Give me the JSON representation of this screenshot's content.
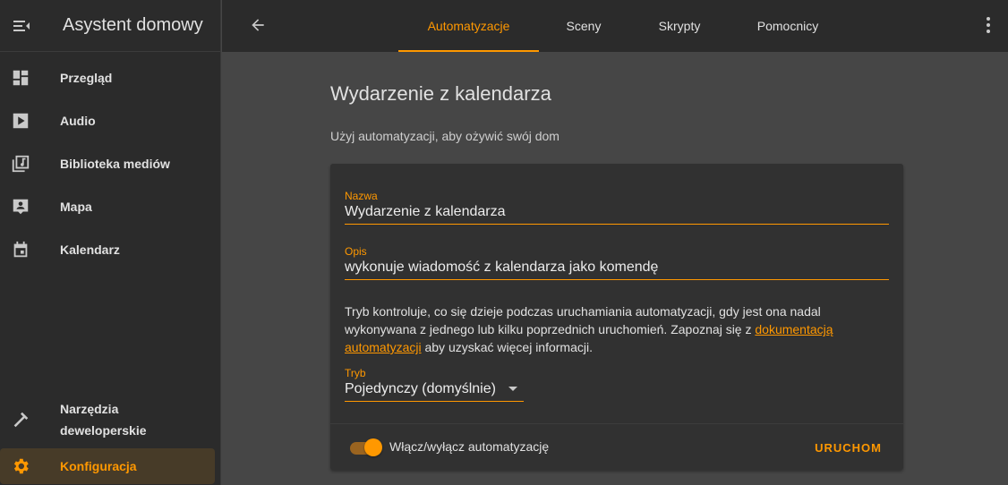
{
  "colors": {
    "accent": "#ff9800",
    "sidebar_bg": "#2b2b2b",
    "main_bg": "#464646",
    "card_bg": "#313131"
  },
  "sidebar": {
    "title": "Asystent domowy",
    "items": [
      {
        "label": "Przegląd",
        "icon": "dashboard-icon"
      },
      {
        "label": "Audio",
        "icon": "play-icon"
      },
      {
        "label": "Biblioteka mediów",
        "icon": "media-library-icon"
      },
      {
        "label": "Mapa",
        "icon": "map-person-icon"
      },
      {
        "label": "Kalendarz",
        "icon": "calendar-icon"
      }
    ],
    "bottom_items": [
      {
        "label": "Narzędzia deweloperskie",
        "icon": "hammer-icon"
      },
      {
        "label": "Konfiguracja",
        "icon": "gear-icon",
        "active": true
      }
    ]
  },
  "topbar": {
    "tabs": [
      {
        "label": "Automatyzacje",
        "active": true
      },
      {
        "label": "Sceny"
      },
      {
        "label": "Skrypty"
      },
      {
        "label": "Pomocnicy"
      }
    ]
  },
  "page": {
    "heading": "Wydarzenie z kalendarza",
    "subheading": "Użyj automatyzacji, aby ożywić swój dom"
  },
  "form": {
    "name_label": "Nazwa",
    "name_value": "Wydarzenie z kalendarza",
    "description_label": "Opis",
    "description_value": "wykonuje wiadomość z kalendarza jako komendę",
    "help_text_before": "Tryb kontroluje, co się dzieje podczas uruchamiania automatyzacji, gdy jest ona nadal wykonywana z jednego lub kilku poprzednich uruchomień. Zapoznaj się z ",
    "help_link": "dokumentacją automatyzacji",
    "help_text_after": " aby uzyskać więcej informacji.",
    "mode_label": "Tryb",
    "mode_value": "Pojedynczy (domyślnie)",
    "toggle_label": "Włącz/wyłącz automatyzację",
    "toggle_on": true,
    "run_label": "URUCHOM"
  }
}
